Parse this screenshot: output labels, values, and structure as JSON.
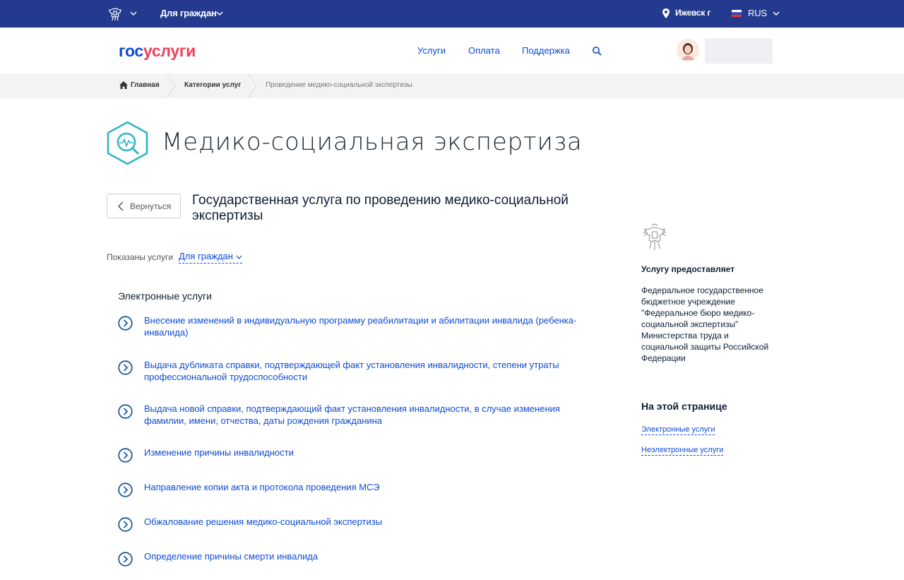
{
  "topbar": {
    "audience": "Для граждан",
    "city": "Ижевск г",
    "language": "RUS"
  },
  "header": {
    "logo_part1": "гос",
    "logo_part2": "услуги",
    "nav": [
      "Услуги",
      "Оплата",
      "Поддержка"
    ]
  },
  "breadcrumbs": [
    "Главная",
    "Категории услуг",
    "Проведение медико-социальной экспертизы"
  ],
  "page": {
    "title": "Медико-социальная экспертиза",
    "back_label": "Вернуться",
    "service_title": "Государственная услуга по проведению медико-социальной экспертизы",
    "filter_label": "Показаны услуги",
    "filter_value": "Для граждан",
    "section_title": "Электронные услуги",
    "services": [
      "Внесение изменений в индивидуальную программу реабилитации и абилитации инвалида (ребенка-инвалида)",
      "Выдача дубликата справки, подтверждающей факт установления инвалидности, степени утраты профессиональной трудоспособности",
      "Выдача новой справки, подтверждающий факт установления инвалидности, в случае изменения фамилии, имени, отчества, даты рождения гражданина",
      "Изменение причины инвалидности",
      "Направление копии акта и протокола проведения МСЭ",
      "Обжалование решения медико-социальной экспертизы",
      "Определение причины смерти инвалида"
    ]
  },
  "sidebar": {
    "provider_heading": "Услугу предоставляет",
    "provider_text": "Федеральное государственное бюджетное учреждение \"Федеральное бюро медико-социальной экспертизы\" Министерства труда и социальной защиты Российской Федерации",
    "onpage_heading": "На этой странице",
    "onpage_links": [
      "Электронные услуги",
      "Неэлектронные услуги"
    ]
  },
  "colors": {
    "topbar": "#233a8e",
    "link": "#0d4cd3",
    "logo_red": "#ee3f58",
    "accent_teal": "#2fb3c3",
    "arrow_blue": "#1e5a9f"
  },
  "icons": [
    "emblem-icon",
    "chevron-down-icon",
    "location-pin-icon",
    "flag-icon",
    "search-icon",
    "avatar",
    "home-icon",
    "medical-expertise-icon",
    "chevron-left-icon",
    "arrow-right-circle-icon"
  ]
}
